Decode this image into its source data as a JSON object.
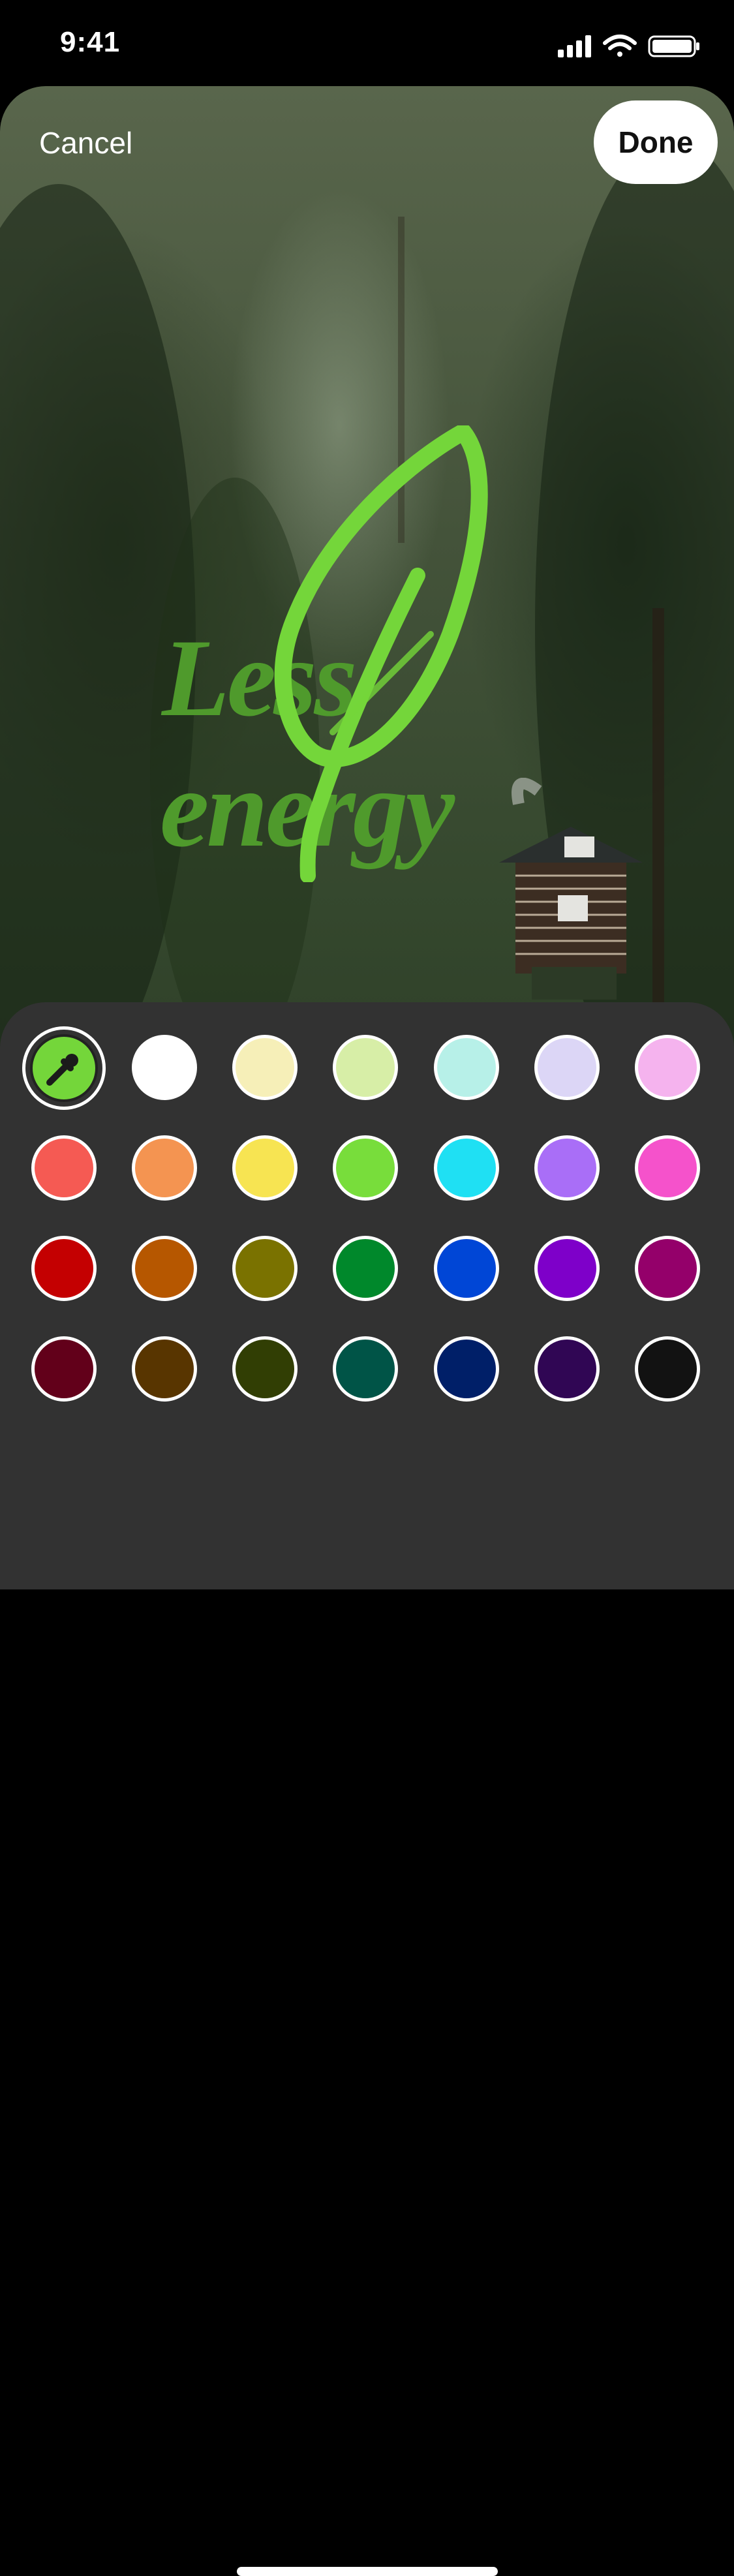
{
  "status_bar": {
    "time": "9:41"
  },
  "header": {
    "cancel_label": "Cancel",
    "done_label": "Done"
  },
  "sticker": {
    "line1": "Less",
    "line2": "energy",
    "color": "#4f9a2c",
    "leaf_color": "#7bde3f"
  },
  "palette": {
    "selected_icon": "eyedropper-icon",
    "selected_color": "#74d63a",
    "rows": [
      [
        "#ffffff",
        "#f6efb8",
        "#d7eea7",
        "#b7f0e8",
        "#dcd6f6",
        "#f5b3ee"
      ],
      [
        "#f55a53",
        "#f49451",
        "#f7e452",
        "#78dd3b",
        "#1fe0f3",
        "#a96ef7",
        "#f552cb"
      ],
      [
        "#c40001",
        "#b65700",
        "#7a7200",
        "#00882b",
        "#0046d6",
        "#7e00c9",
        "#94006a"
      ],
      [
        "#62001a",
        "#583500",
        "#313e04",
        "#005447",
        "#001f68",
        "#300654",
        "#121212"
      ]
    ]
  }
}
